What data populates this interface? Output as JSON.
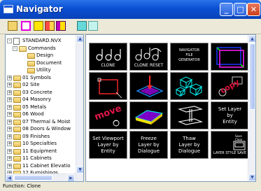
{
  "window": {
    "title": "Navigator"
  },
  "title_buttons": [
    "_",
    "□",
    "✕"
  ],
  "toolbar": {
    "icons": [
      "open-icon",
      "magenta-square-icon",
      "yellow-square-icon",
      "multi-folder-icon",
      "layer-icon",
      "cyan-square-icon",
      "aqua-square-icon"
    ]
  },
  "tree": {
    "items": [
      {
        "label": "STANDARD.NVX",
        "expander": "-"
      },
      {
        "label": "Commands",
        "expander": "-"
      },
      {
        "label": "Design"
      },
      {
        "label": "Document"
      },
      {
        "label": "Utility"
      },
      {
        "label": "01 Symbols",
        "expander": "+"
      },
      {
        "label": "02 Site",
        "expander": "+"
      },
      {
        "label": "03 Concrete",
        "expander": "+"
      },
      {
        "label": "04 Masonry",
        "expander": "+"
      },
      {
        "label": "05 Metals",
        "expander": "+"
      },
      {
        "label": "06 Wood",
        "expander": "+"
      },
      {
        "label": "07 Thermal & Moist",
        "expander": "+"
      },
      {
        "label": "08 Doors & Window",
        "expander": "+"
      },
      {
        "label": "09 Finishes",
        "expander": "+"
      },
      {
        "label": "10 Specialties",
        "expander": "+"
      },
      {
        "label": "11 Equipment",
        "expander": "+"
      },
      {
        "label": "11 Cabinets",
        "expander": "+"
      },
      {
        "label": "11 Cabinet Elevatio",
        "expander": "+"
      },
      {
        "label": "12 Furnishings",
        "expander": "+"
      }
    ]
  },
  "commands": {
    "clone": "CLONE",
    "clone_reset": "CLONE RESET",
    "navgen": "NAVIGATOR\nFILE\nGENERATOR",
    "copy": "copy",
    "move": "move",
    "set_layer_entity": "Set Layer\nby\nEntity",
    "set_viewport": "Set Viewport\nLayer by\nEntity",
    "freeze_layer": "Freeze\nLayer by\nDialogue",
    "thaw_layer": "Thaw\nLayer by\nDialogue",
    "layer_style_top": "Save",
    "layer_style_mid": "Clear",
    "layer_style_label": "LAYER STYLE SAVE"
  },
  "status": {
    "text": "Function: Clone"
  },
  "colors": {
    "title_blue": "#0a4fd3",
    "copy_red": "#e0103a",
    "move_red": "#e01848",
    "accent_cyan": "#00e5e5"
  }
}
